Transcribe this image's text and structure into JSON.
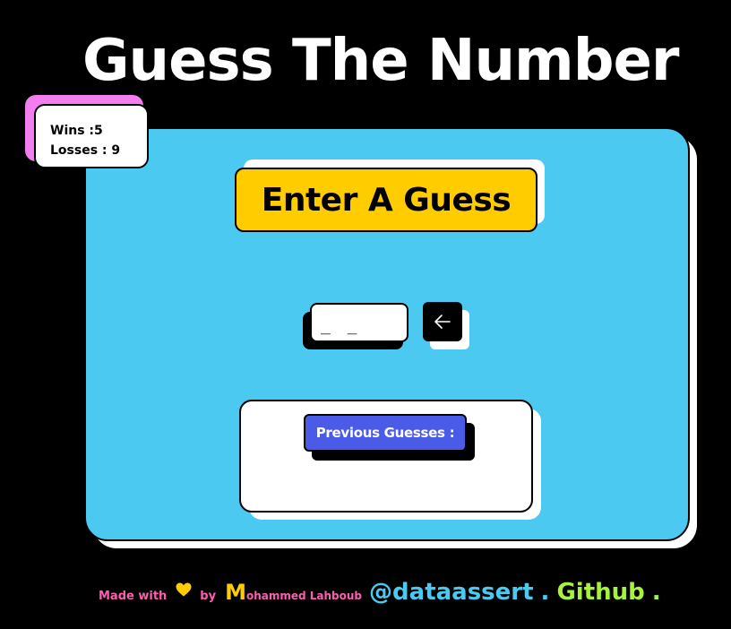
{
  "app": {
    "title": "Guess The Number"
  },
  "score": {
    "wins_label": "Wins :",
    "wins_value": "5",
    "losses_label": "Losses : ",
    "losses_value": "9"
  },
  "game": {
    "heading": "Enter A Guess",
    "guess_input": {
      "value": "",
      "placeholder": "_ _"
    },
    "submit_icon": "arrow-left-icon",
    "previous_guesses_label": "Previous Guesses :",
    "previous_guesses": []
  },
  "footer": {
    "made_with": "Made with",
    "heart_icon": "heart-icon",
    "by": "by",
    "author_initial": "M",
    "author_rest": "ohammed Lahboub",
    "handle": "@dataassert",
    "separator": ".",
    "github": "Github",
    "end": "."
  },
  "colors": {
    "background": "#000000",
    "card": "#4cc9f0",
    "banner": "#ffcc00",
    "score_accent": "#f47ef0",
    "previous_label": "#4a5be8",
    "footer_pink": "#ff5db1",
    "footer_yellow": "#ffcc00",
    "footer_blue": "#4cc9f0",
    "footer_green": "#a7f23a"
  }
}
